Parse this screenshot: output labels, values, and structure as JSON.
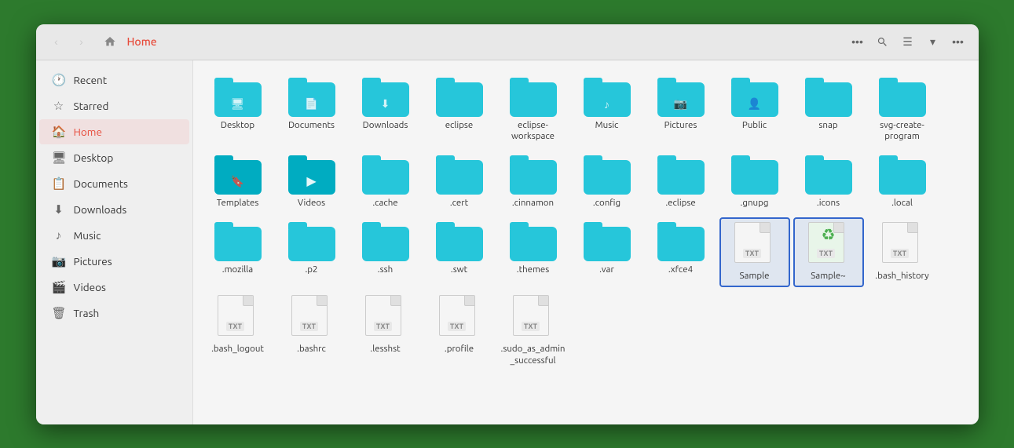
{
  "window": {
    "title": "Home",
    "path": "Home"
  },
  "titlebar": {
    "back_label": "‹",
    "forward_label": "›",
    "more_label": "•••",
    "search_label": "🔍",
    "view_label": "☰",
    "down_label": "▾",
    "menu_label": "•••"
  },
  "sidebar": {
    "items": [
      {
        "id": "recent",
        "label": "Recent",
        "icon": "🕐"
      },
      {
        "id": "starred",
        "label": "Starred",
        "icon": "☆"
      },
      {
        "id": "home",
        "label": "Home",
        "icon": "🏠",
        "active": true
      },
      {
        "id": "desktop",
        "label": "Desktop",
        "icon": "🖥"
      },
      {
        "id": "documents",
        "label": "Documents",
        "icon": "📋"
      },
      {
        "id": "downloads",
        "label": "Downloads",
        "icon": "⬇"
      },
      {
        "id": "music",
        "label": "Music",
        "icon": "♪"
      },
      {
        "id": "pictures",
        "label": "Pictures",
        "icon": "📷"
      },
      {
        "id": "videos",
        "label": "Videos",
        "icon": "🎬"
      },
      {
        "id": "trash",
        "label": "Trash",
        "icon": "🗑"
      }
    ]
  },
  "files": {
    "folders": [
      {
        "id": "desktop",
        "label": "Desktop",
        "type": "folder",
        "overlay": "🖥"
      },
      {
        "id": "documents",
        "label": "Documents",
        "type": "folder",
        "overlay": "📄"
      },
      {
        "id": "downloads",
        "label": "Downloads",
        "type": "folder",
        "overlay": "⬇"
      },
      {
        "id": "eclipse",
        "label": "eclipse",
        "type": "folder",
        "overlay": ""
      },
      {
        "id": "eclipse-workspace",
        "label": "eclipse-\nworkspace",
        "type": "folder",
        "overlay": ""
      },
      {
        "id": "music",
        "label": "Music",
        "type": "folder",
        "overlay": "♪"
      },
      {
        "id": "pictures",
        "label": "Pictures",
        "type": "folder",
        "overlay": "📷"
      },
      {
        "id": "public",
        "label": "Public",
        "type": "folder",
        "overlay": "👤"
      },
      {
        "id": "snap",
        "label": "snap",
        "type": "folder",
        "overlay": ""
      },
      {
        "id": "svg-create-program",
        "label": "svg-create-\nprogram",
        "type": "folder",
        "overlay": ""
      },
      {
        "id": "templates",
        "label": "Templates",
        "type": "folder-special",
        "overlay": "🔖"
      },
      {
        "id": "videos",
        "label": "Videos",
        "type": "folder-special",
        "overlay": "▶"
      },
      {
        "id": "cache",
        "label": ".cache",
        "type": "folder",
        "overlay": ""
      },
      {
        "id": "cert",
        "label": ".cert",
        "type": "folder",
        "overlay": ""
      },
      {
        "id": "cinnamon",
        "label": ".cinnamon",
        "type": "folder",
        "overlay": ""
      },
      {
        "id": "config",
        "label": ".config",
        "type": "folder",
        "overlay": ""
      },
      {
        "id": "eclipse2",
        "label": ".eclipse",
        "type": "folder",
        "overlay": ""
      },
      {
        "id": "gnupg",
        "label": ".gnupg",
        "type": "folder",
        "overlay": ""
      },
      {
        "id": "icons",
        "label": ".icons",
        "type": "folder",
        "overlay": ""
      },
      {
        "id": "local",
        "label": ".local",
        "type": "folder",
        "overlay": ""
      },
      {
        "id": "mozilla",
        "label": ".mozilla",
        "type": "folder",
        "overlay": ""
      },
      {
        "id": "p2",
        "label": ".p2",
        "type": "folder",
        "overlay": ""
      },
      {
        "id": "ssh",
        "label": ".ssh",
        "type": "folder",
        "overlay": ""
      },
      {
        "id": "swt",
        "label": ".swt",
        "type": "folder",
        "overlay": ""
      },
      {
        "id": "themes",
        "label": ".themes",
        "type": "folder",
        "overlay": ""
      },
      {
        "id": "var",
        "label": ".var",
        "type": "folder",
        "overlay": ""
      },
      {
        "id": "xfce4",
        "label": ".xfce4",
        "type": "folder",
        "overlay": ""
      }
    ],
    "txt_files": [
      {
        "id": "sample",
        "label": "Sample",
        "type": "txt",
        "selected": true
      },
      {
        "id": "sample-tilde",
        "label": "Sample~",
        "type": "txt-recycle",
        "selected": true
      },
      {
        "id": "bash-history",
        "label": ".bash_hist\nory",
        "type": "txt"
      }
    ],
    "script_files": [
      {
        "id": "bash-logout",
        "label": ".bash_logo\nut",
        "type": "txt"
      },
      {
        "id": "bashrc",
        "label": ".bashrc",
        "type": "txt"
      },
      {
        "id": "lesshst",
        "label": ".lesshst",
        "type": "txt"
      },
      {
        "id": "profile",
        "label": ".profile",
        "type": "txt"
      },
      {
        "id": "sudo-admin",
        "label": ".sudo_as_a\ndmin_succ\nessful",
        "type": "txt"
      }
    ]
  }
}
